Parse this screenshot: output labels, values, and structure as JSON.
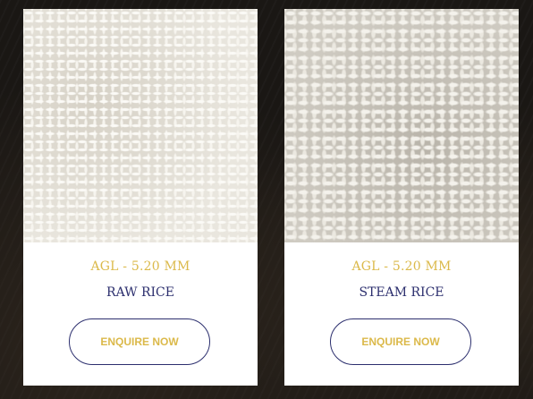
{
  "products": [
    {
      "image_alt": "raw-rice-grains",
      "spec": "AGL - 5.20 MM",
      "name": "RAW RICE",
      "button_label": "ENQUIRE NOW"
    },
    {
      "image_alt": "steam-rice-grains",
      "spec": "AGL - 5.20 MM",
      "name": "STEAM RICE",
      "button_label": "ENQUIRE NOW"
    }
  ],
  "colors": {
    "spec_text": "#dbb94a",
    "name_text": "#2c2f6e",
    "button_border": "#2c2f6e",
    "button_text": "#dbb94a",
    "card_bg": "#ffffff",
    "page_bg": "#1a1714"
  }
}
